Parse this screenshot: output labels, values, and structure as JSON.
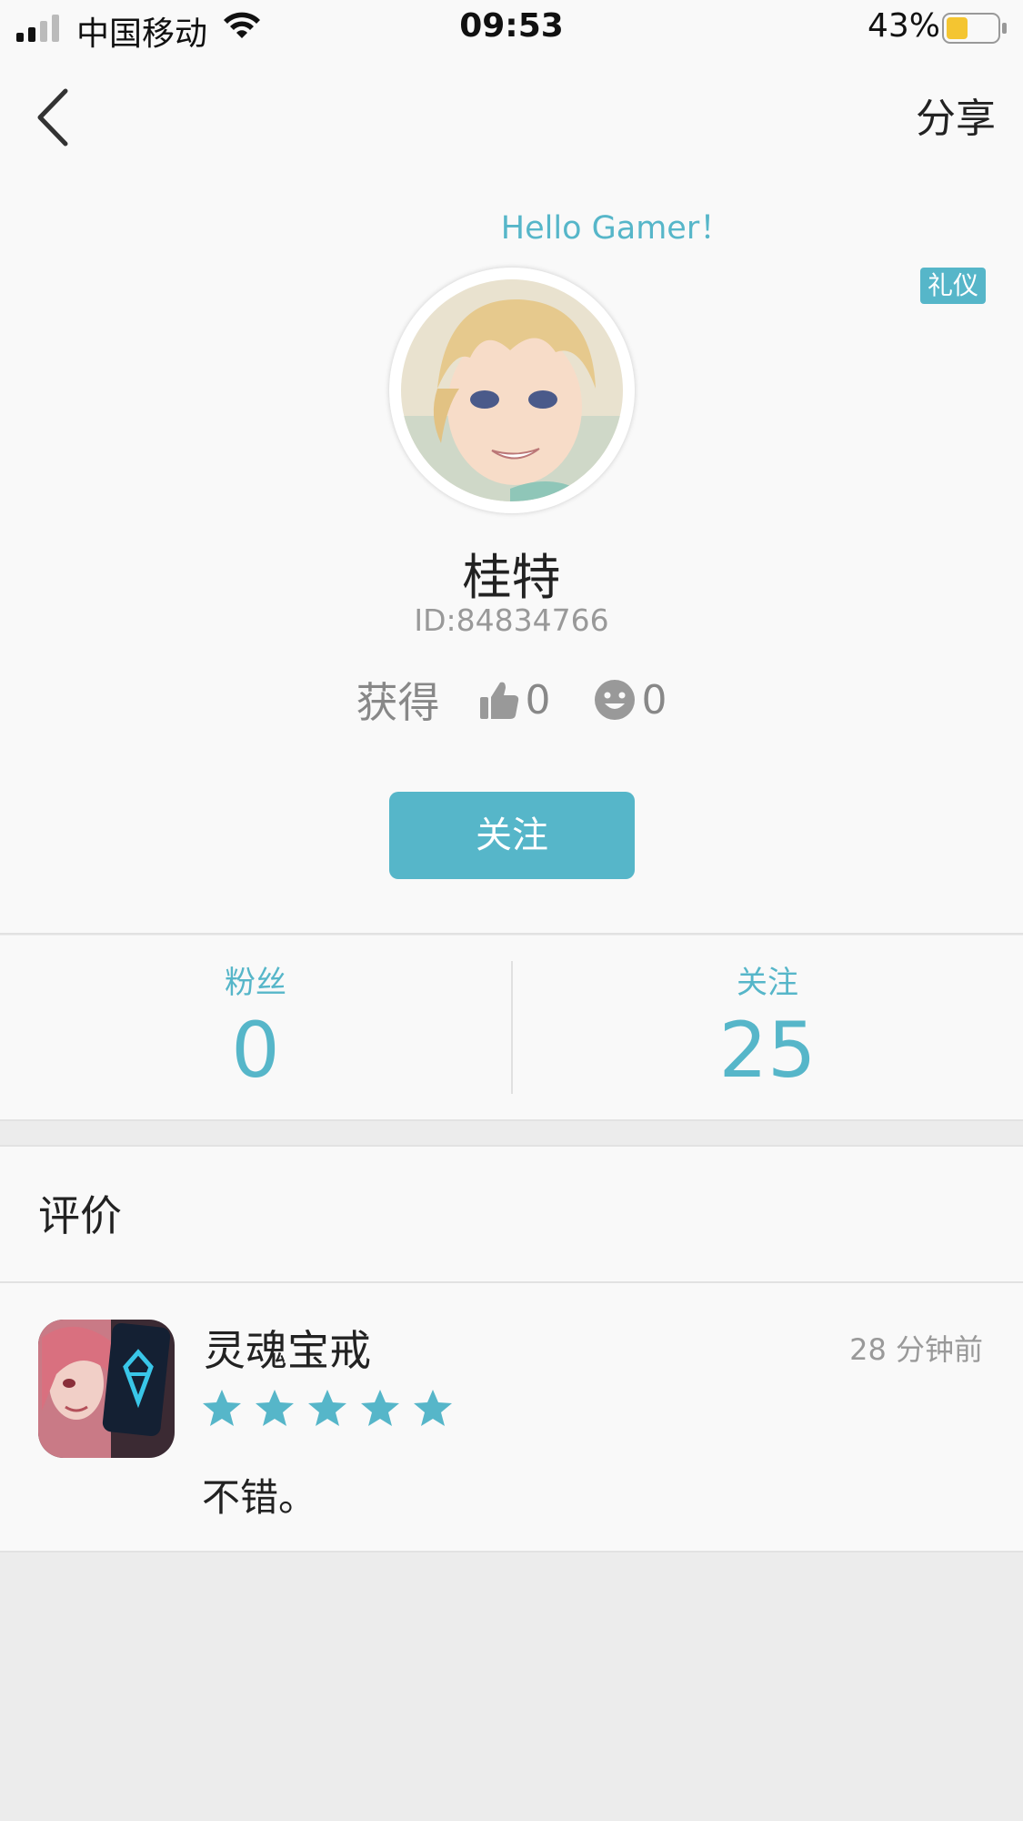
{
  "status_bar": {
    "carrier": "中国移动",
    "time": "09:53",
    "battery": "43%",
    "battery_level": 0.43
  },
  "nav": {
    "back_icon": "chevron-left-icon",
    "share_label": "分享"
  },
  "profile": {
    "greeting": "Hello Gamer！",
    "tag": "礼仪",
    "nickname": "桂特",
    "user_id": "ID:84834766",
    "earned_label": "获得",
    "likes": "0",
    "smiles": "0",
    "follow_button": "关注"
  },
  "counts": {
    "fans_label": "粉丝",
    "fans_value": "0",
    "following_label": "关注",
    "following_value": "25"
  },
  "reviews": {
    "title": "评价",
    "items": [
      {
        "game": "灵魂宝戒",
        "time": "28 分钟前",
        "rating": 5,
        "text": "不错。"
      }
    ]
  },
  "colors": {
    "accent": "#56b6c9",
    "background": "#f9f9f9",
    "page_bg": "#ececec"
  }
}
